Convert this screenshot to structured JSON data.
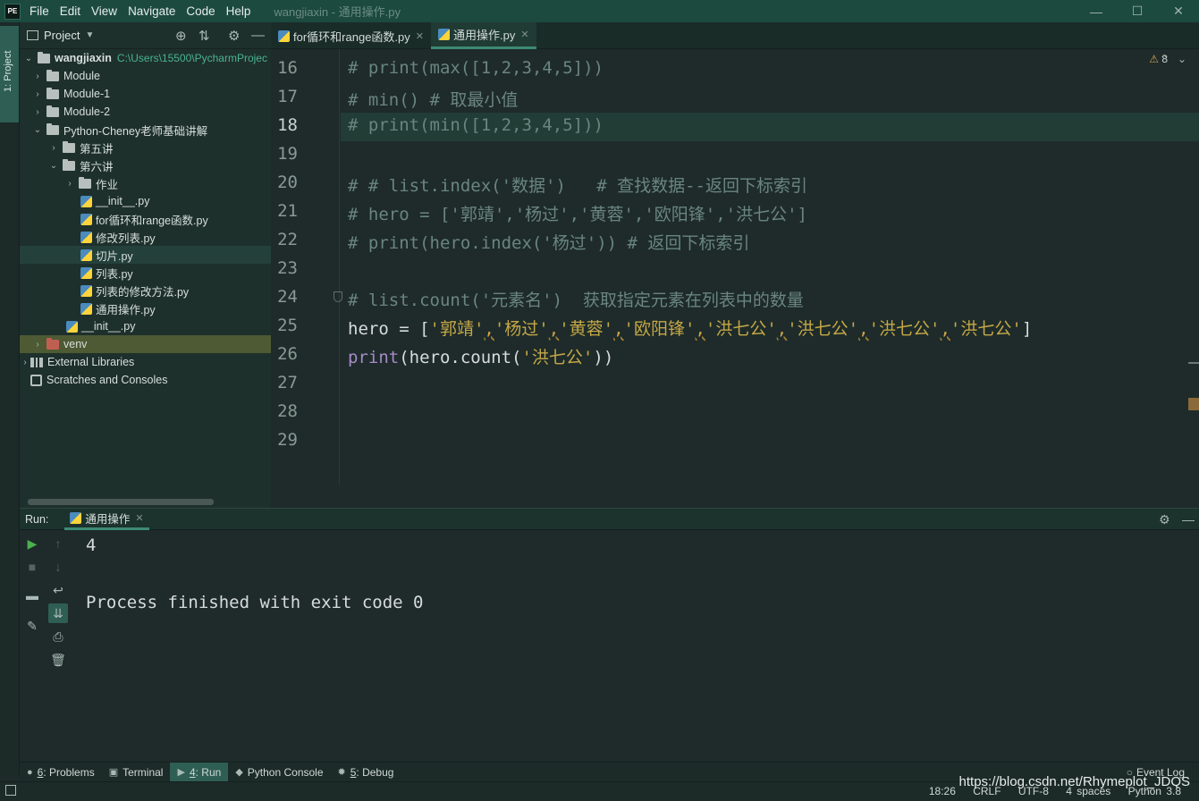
{
  "app": {
    "logo_text": "PE",
    "menu": [
      "File",
      "Edit",
      "View",
      "Navigate",
      "Code",
      "Help"
    ],
    "window_title": "wangjiaxin - 通用操作.py",
    "window_buttons": {
      "minimize": "—",
      "maximize": "☐",
      "close": "✕"
    }
  },
  "left_strip": {
    "project_tab": "1: Project"
  },
  "project_panel": {
    "header": "Project",
    "tree": {
      "root_name": "wangjiaxin",
      "root_path": "C:\\Users\\15500\\PycharmProjec",
      "module": "Module",
      "module1": "Module-1",
      "module2": "Module-2",
      "python_cheney": "Python-Cheney老师基础讲解",
      "lesson5": "第五讲",
      "lesson6": "第六讲",
      "homework": "作业",
      "files": [
        "__init__.py",
        "for循环和range函数.py",
        "修改列表.py",
        "切片.py",
        "列表.py",
        "列表的修改方法.py",
        "通用操作.py"
      ],
      "outer_init": "__init__.py",
      "venv": "venv",
      "external_libraries": "External Libraries",
      "scratches": "Scratches and Consoles"
    }
  },
  "editor_tabs": [
    {
      "label": "for循环和range函数.py",
      "close": "✕"
    },
    {
      "label": "通用操作.py",
      "close": "✕"
    }
  ],
  "editor": {
    "inspection_count": "8",
    "line_numbers": [
      "16",
      "17",
      "18",
      "19",
      "20",
      "21",
      "22",
      "23",
      "24",
      "25",
      "26",
      "27",
      "28",
      "29"
    ],
    "current_line": "18",
    "lines": {
      "l16": "# print(max([1,2,3,4,5]))",
      "l17": "# min() # 取最小值",
      "l18": "# print(min([1,2,3,4,5]))",
      "l20": "# # list.index('数据')   # 查找数据--返回下标索引",
      "l21": "# hero = ['郭靖','杨过','黄蓉','欧阳锋','洪七公']",
      "l22": "# print(hero.index('杨过')) # 返回下标索引",
      "l24": "# list.count('元素名')  获取指定元素在列表中的数量",
      "l25_prefix": "hero = [",
      "l25_items": [
        "'郭靖'",
        "'杨过'",
        "'黄蓉'",
        "'欧阳锋'",
        "'洪七公'",
        "'洪七公'",
        "'洪七公'",
        "'洪七公'"
      ],
      "l25_suffix": "]",
      "l26_kw": "print",
      "l26_mid": "(hero.count(",
      "l26_str": "'洪七公'",
      "l26_end": "))"
    }
  },
  "run_panel": {
    "label": "Run:",
    "tab": "通用操作",
    "tab_close": "✕",
    "output": [
      "4",
      "",
      "Process finished with exit code 0"
    ]
  },
  "tool_windows": [
    {
      "num": "6",
      "label": ": Problems",
      "icon": "problems-icon"
    },
    {
      "num": "",
      "label": "Terminal",
      "icon": "terminal-icon"
    },
    {
      "num": "4",
      "label": ": Run",
      "icon": "run-icon"
    },
    {
      "num": "",
      "label": "Python Console",
      "icon": "python-console-icon"
    },
    {
      "num": "5",
      "label": ": Debug",
      "icon": "debug-icon"
    }
  ],
  "event_log": "Event Log",
  "status_bar": {
    "position": "18:26",
    "line_sep": "CRLF",
    "encoding": "UTF-8",
    "indent": "4 spaces",
    "interpreter": "Python 3.8"
  },
  "watermark": "https://blog.csdn.net/Rhymeplot_JDQS"
}
